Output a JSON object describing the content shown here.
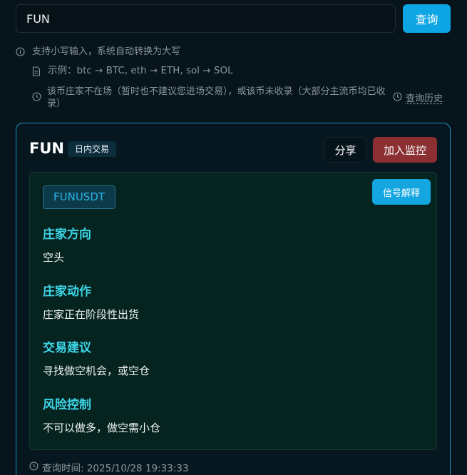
{
  "search": {
    "value": "FUN",
    "button_label": "查询"
  },
  "hints": {
    "tip": "支持小写输入，系统自动转换为大写",
    "example": "示例：btc → BTC, eth → ETH, sol → SOL",
    "warning": "该币庄家不在场（暂时也不建议您进场交易），或该币未收录（大部分主流币均已收录）",
    "history_link": "查询历史"
  },
  "card": {
    "coin": "FUN",
    "mode_badge": "日内交易",
    "share_label": "分享",
    "monitor_label": "加入监控",
    "symbol": "FUNUSDT",
    "explain_label": "信号解释",
    "sections": [
      {
        "title": "庄家方向",
        "text": "空头"
      },
      {
        "title": "庄家动作",
        "text": "庄家正在阶段性出货"
      },
      {
        "title": "交易建议",
        "text": "寻找做空机会，或空仓"
      },
      {
        "title": "风险控制",
        "text": "不可以做多，做空需小仓"
      }
    ],
    "query_time": "查询时间: 2025/10/28 19:33:33"
  },
  "colors": {
    "accent": "#0ea5e4",
    "section_title": "#3dd4e6",
    "danger": "#8b2f33",
    "card_border": "#1b8fc0"
  }
}
